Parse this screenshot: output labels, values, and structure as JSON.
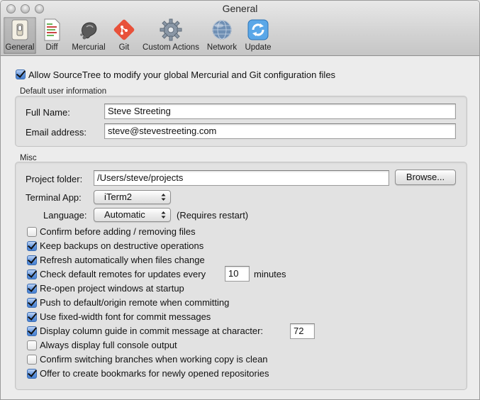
{
  "window": {
    "title": "General"
  },
  "toolbar": {
    "items": [
      {
        "label": "General",
        "icon": "switch-icon"
      },
      {
        "label": "Diff",
        "icon": "document-icon"
      },
      {
        "label": "Mercurial",
        "icon": "mercurial-icon"
      },
      {
        "label": "Git",
        "icon": "git-icon"
      },
      {
        "label": "Custom Actions",
        "icon": "gear-icon"
      },
      {
        "label": "Network",
        "icon": "network-globe-icon"
      },
      {
        "label": "Update",
        "icon": "update-icon"
      }
    ],
    "selected": "General"
  },
  "allow_config": {
    "label": "Allow SourceTree to modify your global Mercurial and Git configuration files",
    "checked": true
  },
  "user_info": {
    "heading": "Default user information",
    "full_name_label": "Full Name:",
    "full_name_value": "Steve Streeting",
    "email_label": "Email address:",
    "email_value": "steve@stevestreeting.com"
  },
  "misc": {
    "heading": "Misc",
    "project_folder_label": "Project folder:",
    "project_folder_value": "/Users/steve/projects",
    "browse_label": "Browse...",
    "terminal_label": "Terminal App:",
    "terminal_value": "iTerm2",
    "language_label": "Language:",
    "language_value": "Automatic",
    "language_note": "(Requires restart)",
    "options": [
      {
        "label": "Confirm before adding / removing files",
        "checked": false
      },
      {
        "label": "Keep backups on destructive operations",
        "checked": true
      },
      {
        "label": "Refresh automatically when files change",
        "checked": true
      },
      {
        "label": "Check default remotes for updates every",
        "checked": true,
        "value": "10",
        "suffix": "minutes"
      },
      {
        "label": "Re-open project windows at startup",
        "checked": true
      },
      {
        "label": "Push to default/origin remote when committing",
        "checked": true
      },
      {
        "label": "Use fixed-width font for commit messages",
        "checked": true
      },
      {
        "label": "Display column guide in commit message at character:",
        "checked": true,
        "value": "72"
      },
      {
        "label": "Always display full console output",
        "checked": false
      },
      {
        "label": "Confirm switching branches when working copy is clean",
        "checked": false
      },
      {
        "label": "Offer to create bookmarks for newly opened repositories",
        "checked": true
      }
    ]
  }
}
